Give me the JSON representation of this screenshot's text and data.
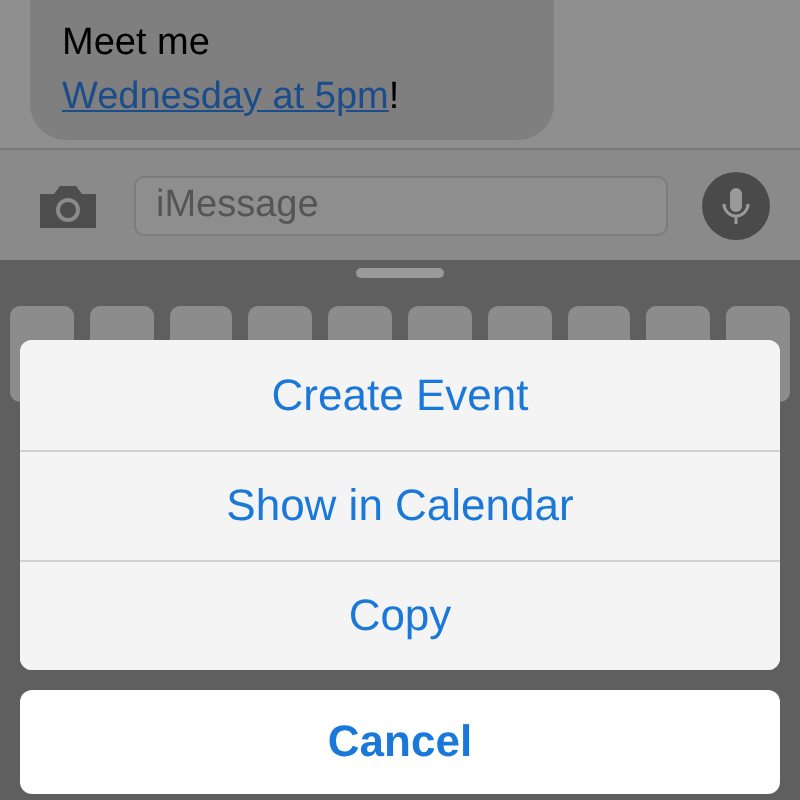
{
  "message": {
    "before": "Meet me ",
    "link": "Wednesday at 5pm",
    "after": "!"
  },
  "compose": {
    "placeholder": "iMessage"
  },
  "action_sheet": {
    "actions": [
      "Create Event",
      "Show in Calendar",
      "Copy"
    ],
    "cancel": "Cancel"
  }
}
